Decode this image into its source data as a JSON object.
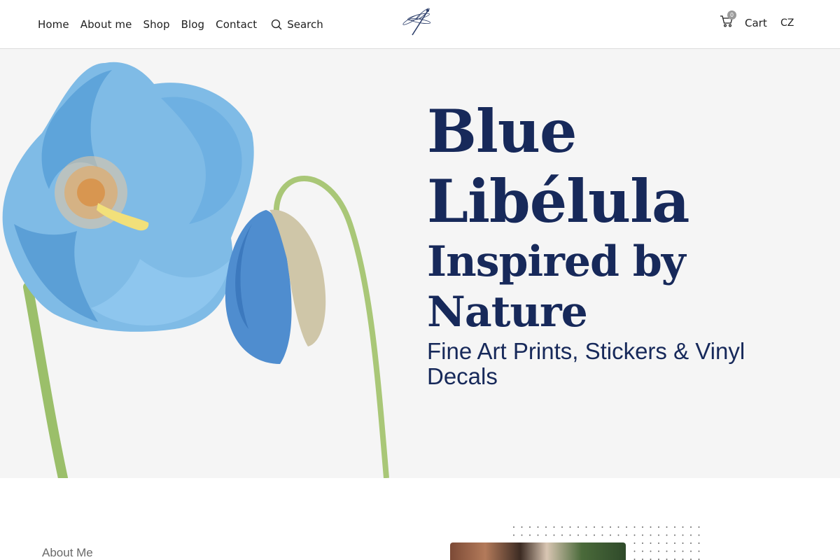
{
  "nav": {
    "items": [
      "Home",
      "About me",
      "Shop",
      "Blog",
      "Contact"
    ],
    "search_label": "Search"
  },
  "cart": {
    "label": "Cart",
    "count": "0"
  },
  "language": "CZ",
  "hero": {
    "title_line1": "Blue",
    "title_line2": "Libélula",
    "subtitle_line1": "Inspired by",
    "subtitle_line2": "Nature",
    "tagline": "Fine Art Prints, Stickers & Vinyl Decals"
  },
  "about": {
    "label": "About Me"
  },
  "colors": {
    "accent": "#17295a",
    "hero_bg": "#f5f5f5",
    "flower_blue": "#6fb0e0",
    "stem_green": "#9bbf6a"
  }
}
